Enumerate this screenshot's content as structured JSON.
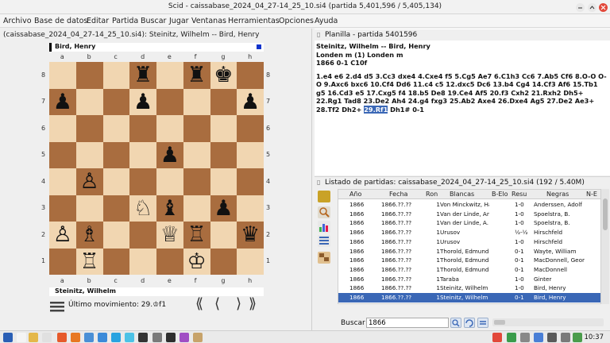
{
  "window": {
    "title": "Scid - caissabase_2024_04_27-14_25_10.si4 (partida 5,401,596 / 5,405,134)"
  },
  "menu": [
    "Archivo",
    "Base de datos",
    "Editar",
    "Partida",
    "Buscar",
    "Jugar",
    "Ventanas",
    "Herramientas",
    "Opciones",
    "Ayuda"
  ],
  "board_pane": {
    "title": "(caissabase_2024_04_27-14_25_10.si4): Steinitz, Wilhelm -- Bird, Henry",
    "top_player": "Bird, Henry",
    "bottom_player": "Steinitz, Wilhelm",
    "files": [
      "a",
      "b",
      "c",
      "d",
      "e",
      "f",
      "g",
      "h"
    ],
    "ranks": [
      "8",
      "7",
      "6",
      "5",
      "4",
      "3",
      "2",
      "1"
    ],
    "last_move": "Último movimiento: 29.♔f1",
    "nav": {
      "start": "⟪",
      "back": "⟨",
      "forward": "⟩",
      "end": "⟫"
    },
    "position": [
      [
        "",
        "",
        "",
        "♜",
        "",
        "♜",
        "♚",
        ""
      ],
      [
        "♟",
        "",
        "",
        "♟",
        "",
        "",
        "",
        "♟"
      ],
      [
        "",
        "",
        "",
        "",
        "",
        "",
        "",
        ""
      ],
      [
        "",
        "",
        "",
        "",
        "♟",
        "",
        "",
        ""
      ],
      [
        "",
        "♙",
        "",
        "",
        "",
        "",
        "",
        ""
      ],
      [
        "",
        "",
        "",
        "♘",
        "♝",
        "",
        "♟",
        ""
      ],
      [
        "♙",
        "♗",
        "",
        "",
        "♕",
        "♖",
        "",
        "♛"
      ],
      [
        "",
        "♖",
        "",
        "",
        "",
        "♔",
        "",
        ""
      ]
    ]
  },
  "notation": {
    "title": "Planilla - partida 5401596",
    "header_line1": "Steinitz, Wilhelm   --   Bird, Henry",
    "header_line2": "Londen m (1)  Londen m",
    "header_line3": "1866  0-1  C10f",
    "moves_before": "1.e4 e6 2.d4 d5 3.Cc3 dxe4 4.Cxe4 f5 5.Cg5 Ae7 6.C1h3 Cc6 7.Ab5 Cf6 8.O-O O-O 9.Axc6 bxc6 10.Cf4 Dd6 11.c4 c5 12.dxc5 Dc6 13.b4 Cg4 14.Cf3 Af6 15.Tb1 g5 16.Cd3 e5 17.Cxg5 f4 18.b5 De8 19.Ce4 Af5 20.f3 Cxh2 21.Rxh2 Dh5+ 22.Rg1 Tad8 23.De2 Ah4 24.g4 fxg3 25.Ab2 Axe4 26.Dxe4 Ag5 27.De2 Ae3+ 28.Tf2 Dh2+ ",
    "current_move": "29.Rf1",
    "moves_after": " Dh1# 0-1"
  },
  "game_list": {
    "title": "Listado de partidas: caissabase_2024_04_27-14_25_10.si4 (192 / 5.40M)",
    "columns": [
      "Año",
      "Fecha",
      "Ron",
      "Blancas",
      "B-Elo",
      "Resu",
      "Negras",
      "N-E"
    ],
    "rows": [
      [
        "1866",
        "1866.??.??",
        "1",
        "Von Minckwitz, Ha",
        "",
        "1-0",
        "Anderssen, Adolf",
        ""
      ],
      [
        "1866",
        "1866.??.??",
        "1",
        "Van der Linde, Ant",
        "",
        "1-0",
        "Spoelstra, B.",
        ""
      ],
      [
        "1866",
        "1866.??.??",
        "1",
        "Van der Linde, A.",
        "",
        "1-0",
        "Spoelstra, B.",
        ""
      ],
      [
        "1866",
        "1866.??.??",
        "1",
        "Urusov",
        "",
        "½-½",
        "Hirschfeld",
        ""
      ],
      [
        "1866",
        "1866.??.??",
        "1",
        "Urusov",
        "",
        "1-0",
        "Hirschfeld",
        ""
      ],
      [
        "1866",
        "1866.??.??",
        "1",
        "Thorold, Edmund",
        "",
        "0-1",
        "Wayte, William",
        ""
      ],
      [
        "1866",
        "1866.??.??",
        "1",
        "Thorold, Edmund",
        "",
        "0-1",
        "MacDonnell, Georg",
        ""
      ],
      [
        "1866",
        "1866.??.??",
        "1",
        "Thorold, Edmund",
        "",
        "0-1",
        "MacDonnell",
        ""
      ],
      [
        "1866",
        "1866.??.??",
        "1",
        "Taraba",
        "",
        "1-0",
        "Ginter",
        ""
      ],
      [
        "1866",
        "1866.??.??",
        "1",
        "Steinitz, Wilhelm",
        "",
        "1-0",
        "Bird, Henry",
        ""
      ],
      [
        "1866",
        "1866.??.??",
        "1",
        "Steinitz, Wilhelm",
        "",
        "0-1",
        "Bird, Henry",
        ""
      ]
    ],
    "selected_row": 10,
    "search_label": "Buscar",
    "search_value": "1866"
  },
  "taskbar": {
    "clock": "10:37"
  },
  "colors": {
    "accent": "#3a67b6",
    "light_square": "#f1d6b1",
    "dark_square": "#a96d3f"
  }
}
